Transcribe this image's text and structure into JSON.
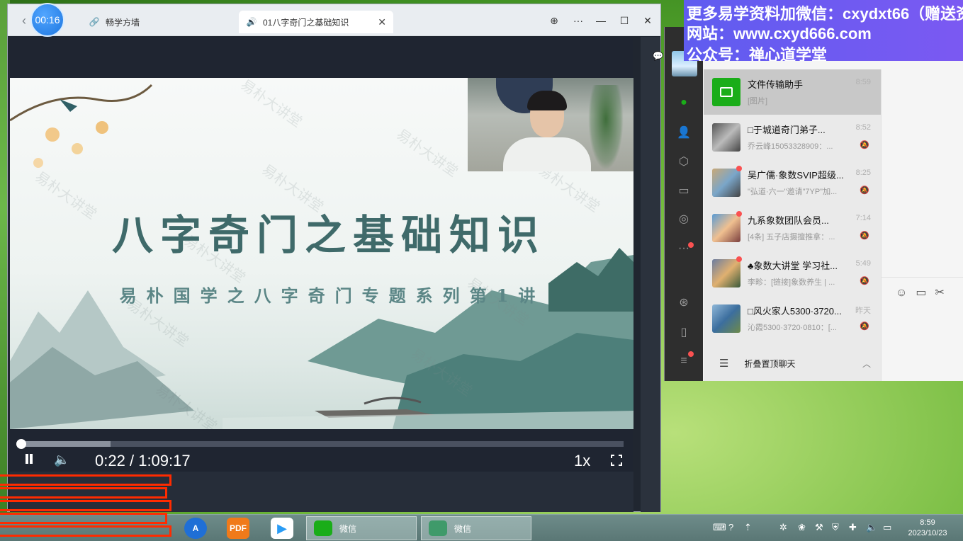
{
  "banner": {
    "line1": "更多易学资料加微信：cxydxt66（赠送资",
    "line2": "网站：www.cxyd666.com",
    "line3": "公众号：禅心道学堂"
  },
  "browser": {
    "timer": "00:16",
    "tabs": [
      {
        "label": "畅学方墙",
        "icon": "link-icon"
      },
      {
        "label": "01八字奇门之基础知识",
        "icon": "speaker-icon"
      }
    ]
  },
  "video": {
    "title": "八字奇门之基础知识",
    "subtitle": "易朴国学之八字奇门专题系列第1讲",
    "watermark": "易朴大讲堂",
    "progress": 0.15,
    "current_time": "0:22",
    "separator": "/",
    "duration": "1:09:17",
    "speed": "1x"
  },
  "wechat": {
    "chats": [
      {
        "name": "文件传输助手",
        "message": "[图片]",
        "time": "8:59",
        "active": true
      },
      {
        "name": "□于城道奇门弟子...",
        "message": "乔云峰15053328909：...",
        "time": "8:52"
      },
      {
        "name": "吴广儒·象数SVIP超级...",
        "message": "\"弘道·六一\"邀请\"7YP\"加...",
        "time": "8:25"
      },
      {
        "name": "九系象数团队会员...",
        "message": "[4条] 五子店摄擅推拿：...",
        "time": "7:14"
      },
      {
        "name": "♣象数大讲堂 学习社...",
        "message": "李畛：[链接]象数养生 | ...",
        "time": "5:49"
      },
      {
        "name": "□风火家人5300·3720...",
        "message": "沁霞5300·3720·0810：[...",
        "time": "昨天"
      }
    ],
    "fold_label": "折叠置顶聊天"
  },
  "taskbar": {
    "tasks": [
      {
        "label": "微信"
      },
      {
        "label": "微信"
      }
    ],
    "clock_time": "8:59",
    "clock_date": "2023/10/23",
    "pdf_label": "PDF"
  },
  "colors": {
    "accent_green": "#1aad19",
    "player_bg": "#1f2531",
    "banner": "#6a5af0"
  }
}
